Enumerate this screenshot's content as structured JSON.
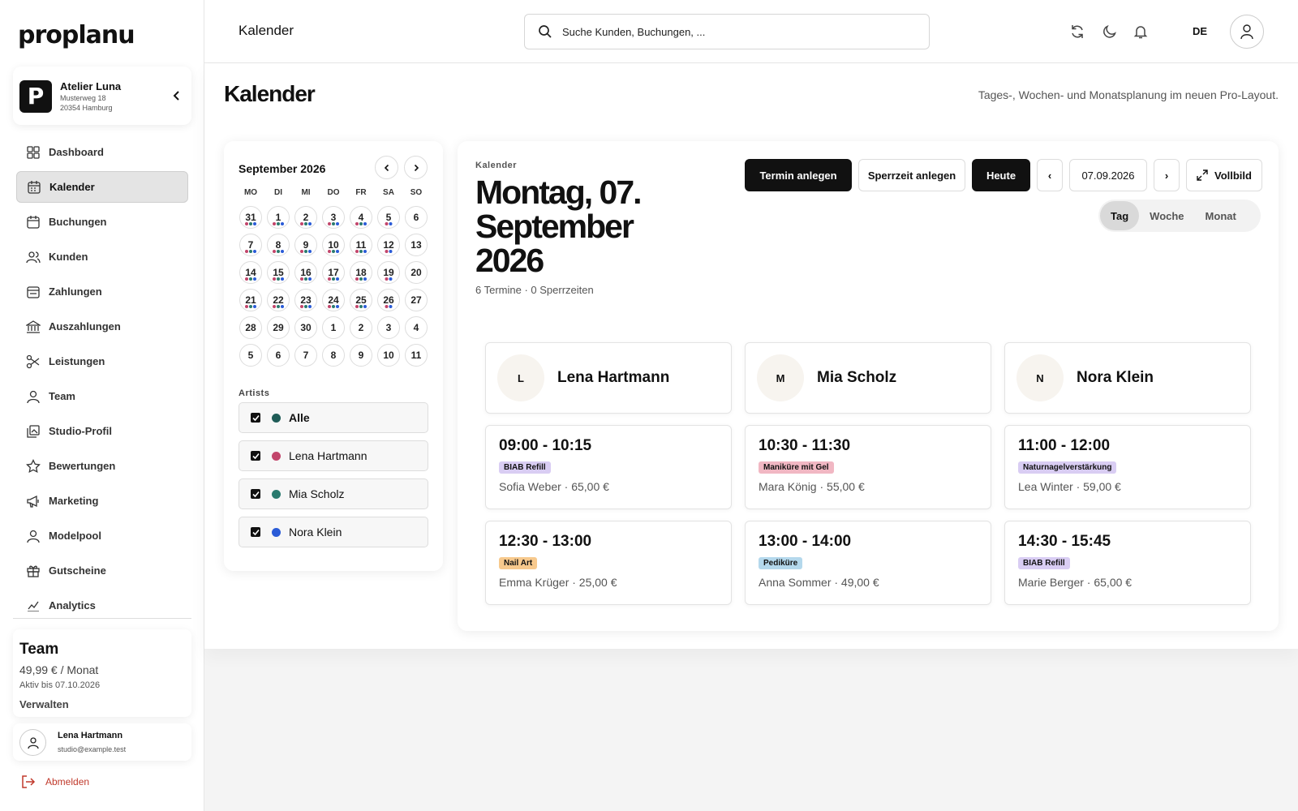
{
  "brand": {
    "logo": "proplanu"
  },
  "studio": {
    "name": "Atelier Luna",
    "street": "Musterweg 18",
    "city": "20354 Hamburg"
  },
  "sidebar": {
    "items": [
      {
        "label": "Dashboard",
        "icon": "grid-icon"
      },
      {
        "label": "Kalender",
        "icon": "calendar-icon",
        "active": true
      },
      {
        "label": "Buchungen",
        "icon": "calendar-check-icon"
      },
      {
        "label": "Kunden",
        "icon": "users-icon"
      },
      {
        "label": "Zahlungen",
        "icon": "wallet-icon"
      },
      {
        "label": "Auszahlungen",
        "icon": "bank-icon"
      },
      {
        "label": "Leistungen",
        "icon": "scissors-icon"
      },
      {
        "label": "Team",
        "icon": "user-icon"
      },
      {
        "label": "Studio-Profil",
        "icon": "image-icon"
      },
      {
        "label": "Bewertungen",
        "icon": "star-icon"
      },
      {
        "label": "Marketing",
        "icon": "megaphone-icon"
      },
      {
        "label": "Modelpool",
        "icon": "user-icon"
      },
      {
        "label": "Gutscheine",
        "icon": "gift-icon"
      },
      {
        "label": "Analytics",
        "icon": "chart-icon"
      }
    ]
  },
  "plan": {
    "name": "Team",
    "price": "49,99 € / Monat",
    "valid": "Aktiv bis 07.10.2026",
    "manage": "Verwalten"
  },
  "user": {
    "name": "Lena Hartmann",
    "email": "studio@example.test"
  },
  "logout": "Abmelden",
  "header": {
    "title": "Kalender",
    "search_placeholder": "Suche Kunden, Buchungen, ...",
    "lang": "DE"
  },
  "page": {
    "title": "Kalender",
    "subtitle": "Tages-, Wochen- und Monatsplanung im neuen Pro-Layout."
  },
  "mini_calendar": {
    "month": "September 2026",
    "weekdays": [
      "MO",
      "DI",
      "MI",
      "DO",
      "FR",
      "SA",
      "SO"
    ],
    "days": [
      {
        "d": "31",
        "dots": [
          "#c2456b",
          "#2a7a6e",
          "#2a5bd7"
        ]
      },
      {
        "d": "1",
        "dots": [
          "#c2456b",
          "#2a7a6e",
          "#2a5bd7"
        ]
      },
      {
        "d": "2",
        "dots": [
          "#c2456b",
          "#2a7a6e",
          "#2a5bd7"
        ]
      },
      {
        "d": "3",
        "dots": [
          "#c2456b",
          "#2a7a6e",
          "#2a5bd7"
        ]
      },
      {
        "d": "4",
        "dots": [
          "#c2456b",
          "#2a7a6e",
          "#2a5bd7"
        ]
      },
      {
        "d": "5",
        "dots": [
          "#c2456b",
          "#2a5bd7"
        ]
      },
      {
        "d": "6",
        "dots": []
      },
      {
        "d": "7",
        "dots": [
          "#c2456b",
          "#2a7a6e",
          "#2a5bd7"
        ]
      },
      {
        "d": "8",
        "dots": [
          "#c2456b",
          "#2a7a6e",
          "#2a5bd7"
        ]
      },
      {
        "d": "9",
        "dots": [
          "#c2456b",
          "#2a7a6e",
          "#2a5bd7"
        ]
      },
      {
        "d": "10",
        "dots": [
          "#c2456b",
          "#2a7a6e",
          "#2a5bd7"
        ]
      },
      {
        "d": "11",
        "dots": [
          "#c2456b",
          "#2a7a6e",
          "#2a5bd7"
        ]
      },
      {
        "d": "12",
        "dots": [
          "#c2456b",
          "#2a5bd7"
        ]
      },
      {
        "d": "13",
        "dots": []
      },
      {
        "d": "14",
        "dots": [
          "#c2456b",
          "#2a7a6e",
          "#2a5bd7"
        ]
      },
      {
        "d": "15",
        "dots": [
          "#c2456b",
          "#2a7a6e",
          "#2a5bd7"
        ]
      },
      {
        "d": "16",
        "dots": [
          "#c2456b",
          "#2a7a6e",
          "#2a5bd7"
        ]
      },
      {
        "d": "17",
        "dots": [
          "#c2456b",
          "#2a7a6e",
          "#2a5bd7"
        ]
      },
      {
        "d": "18",
        "dots": [
          "#c2456b",
          "#2a7a6e",
          "#2a5bd7"
        ]
      },
      {
        "d": "19",
        "dots": [
          "#c2456b",
          "#2a5bd7"
        ]
      },
      {
        "d": "20",
        "dots": []
      },
      {
        "d": "21",
        "dots": [
          "#c2456b",
          "#2a7a6e",
          "#2a5bd7"
        ]
      },
      {
        "d": "22",
        "dots": [
          "#c2456b",
          "#2a7a6e",
          "#2a5bd7"
        ]
      },
      {
        "d": "23",
        "dots": [
          "#c2456b",
          "#2a7a6e",
          "#2a5bd7"
        ]
      },
      {
        "d": "24",
        "dots": [
          "#c2456b",
          "#2a7a6e",
          "#2a5bd7"
        ]
      },
      {
        "d": "25",
        "dots": [
          "#c2456b",
          "#2a7a6e",
          "#2a5bd7"
        ]
      },
      {
        "d": "26",
        "dots": [
          "#c2456b",
          "#2a5bd7"
        ]
      },
      {
        "d": "27",
        "dots": []
      },
      {
        "d": "28",
        "dots": []
      },
      {
        "d": "29",
        "dots": []
      },
      {
        "d": "30",
        "dots": []
      },
      {
        "d": "1",
        "dots": []
      },
      {
        "d": "2",
        "dots": []
      },
      {
        "d": "3",
        "dots": []
      },
      {
        "d": "4",
        "dots": []
      },
      {
        "d": "5",
        "dots": []
      },
      {
        "d": "6",
        "dots": []
      },
      {
        "d": "7",
        "dots": []
      },
      {
        "d": "8",
        "dots": []
      },
      {
        "d": "9",
        "dots": []
      },
      {
        "d": "10",
        "dots": []
      },
      {
        "d": "11",
        "dots": []
      }
    ]
  },
  "artists": {
    "label": "Artists",
    "items": [
      {
        "name": "Alle",
        "color": "#1f5c57",
        "checked": true
      },
      {
        "name": "Lena Hartmann",
        "color": "#c2456b",
        "checked": true
      },
      {
        "name": "Mia Scholz",
        "color": "#2a7a6e",
        "checked": true
      },
      {
        "name": "Nora Klein",
        "color": "#2a5bd7",
        "checked": true
      }
    ]
  },
  "day": {
    "label": "Kalender",
    "date": "Montag, 07. September 2026",
    "summary": "6 Termine · 0 Sperrzeiten",
    "buttons": {
      "new_appt": "Termin anlegen",
      "block": "Sperrzeit anlegen",
      "today": "Heute",
      "prev": "‹",
      "date": "07.09.2026",
      "next": "›",
      "fullscreen": "Vollbild"
    },
    "views": [
      "Tag",
      "Woche",
      "Monat"
    ],
    "active_view": "Tag",
    "columns": [
      {
        "initial": "L",
        "name": "Lena Hartmann",
        "appointments": [
          {
            "time": "09:00 - 10:15",
            "service": "BIAB Refill",
            "tag_color": "#d9cdf3",
            "client": "Sofia Weber · 65,00 €"
          },
          {
            "time": "12:30 - 13:00",
            "service": "Nail Art",
            "tag_color": "#f7c98d",
            "client": "Emma Krüger · 25,00 €"
          }
        ]
      },
      {
        "initial": "M",
        "name": "Mia Scholz",
        "appointments": [
          {
            "time": "10:30 - 11:30",
            "service": "Maniküre mit Gel",
            "tag_color": "#f1b7c3",
            "client": "Mara König · 55,00 €"
          },
          {
            "time": "13:00 - 14:00",
            "service": "Pediküre",
            "tag_color": "#b4d8ec",
            "client": "Anna Sommer · 49,00 €"
          }
        ]
      },
      {
        "initial": "N",
        "name": "Nora Klein",
        "appointments": [
          {
            "time": "11:00 - 12:00",
            "service": "Naturnagelverstärkung",
            "tag_color": "#d9cdf3",
            "client": "Lea Winter · 59,00 €"
          },
          {
            "time": "14:30 - 15:45",
            "service": "BIAB Refill",
            "tag_color": "#d9cdf3",
            "client": "Marie Berger · 65,00 €"
          }
        ]
      }
    ]
  }
}
